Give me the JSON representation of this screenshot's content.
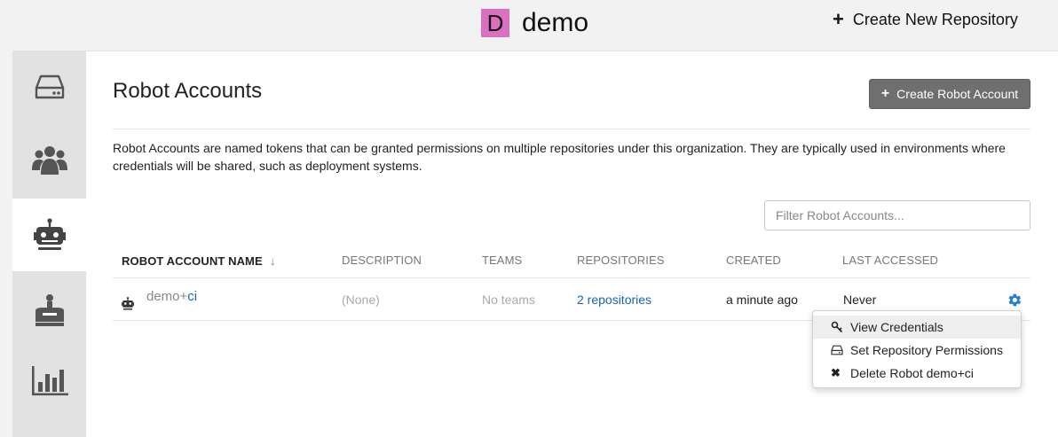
{
  "topbar": {
    "org_initial": "D",
    "org_name": "demo",
    "create_repo_label": "Create New Repository",
    "avatar_color": "#db6fc0"
  },
  "sidebar": {
    "tabs": [
      {
        "name": "repositories",
        "icon": "hdd-icon",
        "active": false
      },
      {
        "name": "teams",
        "icon": "users-icon",
        "active": false
      },
      {
        "name": "robot-accounts",
        "icon": "robot-icon",
        "active": true
      },
      {
        "name": "members",
        "icon": "user-icon",
        "active": false
      },
      {
        "name": "usage-logs",
        "icon": "bar-chart-icon",
        "active": false
      }
    ]
  },
  "page": {
    "title": "Robot Accounts",
    "create_button_label": "Create Robot Account",
    "description": "Robot Accounts are named tokens that can be granted permissions on multiple repositories under this organization. They are typically used in environments where credentials will be shared, such as deployment systems.",
    "filter_placeholder": "Filter Robot Accounts..."
  },
  "table": {
    "columns": [
      "ROBOT ACCOUNT NAME",
      "DESCRIPTION",
      "TEAMS",
      "REPOSITORIES",
      "CREATED",
      "LAST ACCESSED"
    ],
    "sort_arrow": "↓",
    "rows": [
      {
        "name_prefix": "demo+",
        "name_short": "ci",
        "description": "(None)",
        "teams": "No teams",
        "repositories": "2 repositories",
        "created": "a minute ago",
        "last_accessed": "Never"
      }
    ]
  },
  "menu": {
    "items": [
      {
        "label": "View Credentials",
        "icon": "key-icon"
      },
      {
        "label": "Set Repository Permissions",
        "icon": "hdd-icon"
      },
      {
        "label": "Delete Robot demo+ci",
        "icon": "times-icon"
      }
    ]
  },
  "colors": {
    "link": "#1566b7",
    "gear": "#2a7bd4",
    "primary_button": "#6f6f6f"
  }
}
